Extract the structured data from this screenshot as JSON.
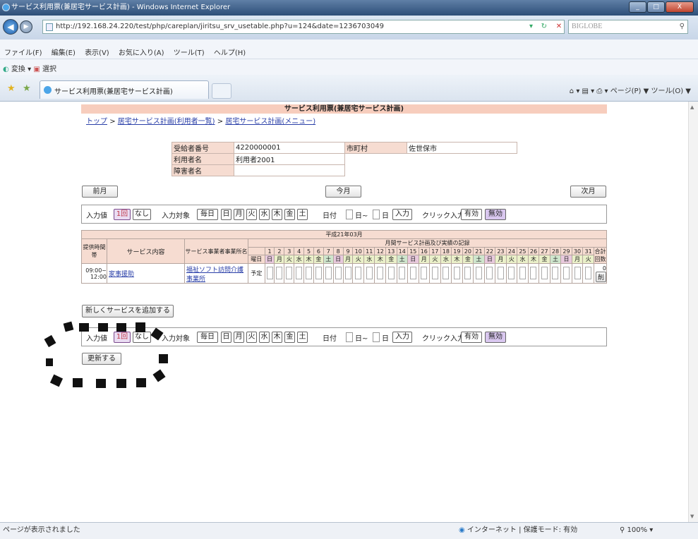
{
  "window": {
    "title": "サービス利用票(兼居宅サービス計画) - Windows Internet Explorer"
  },
  "browser": {
    "address": "http://192.168.24.220/test/php/careplan/jiritsu_srv_usetable.php?u=124&date=1236703049",
    "search_placeholder": "BIGLOBE",
    "menu": [
      "ファイル(F)",
      "編集(E)",
      "表示(V)",
      "お気に入り(A)",
      "ツール(T)",
      "ヘルプ(H)"
    ],
    "links": [
      "変換",
      "選択"
    ],
    "tab_title": "サービス利用票(兼居宅サービス計画)",
    "command_bar": "ページ(P) ▼ ツール(O) ▼",
    "status_text": "ページが表示されました",
    "zone_text": "インターネット | 保護モード: 有効",
    "zoom": "100%"
  },
  "page": {
    "title": "サービス利用票(兼居宅サービス計画)",
    "breadcrumb": [
      "トップ",
      "居宅サービス計画(利用者一覧)",
      "居宅サービス計画(メニュー)"
    ],
    "breadcrumb_sep": ">",
    "info": {
      "recipient_label": "受給者番号",
      "recipient_value": "4220000001",
      "user_label": "利用者名",
      "user_value": "利用者2001",
      "disability_label": "障害者名",
      "city_label": "市町村",
      "city_value": "佐世保市"
    },
    "nav": {
      "prev": "前月",
      "current": "今月",
      "next": "次月"
    },
    "input_row": {
      "value_label": "入力値",
      "once": "1回",
      "none": "なし",
      "target_label": "入力対象",
      "targets": [
        "毎日",
        "日",
        "月",
        "火",
        "水",
        "木",
        "金",
        "土"
      ],
      "date_label": "日付",
      "range_sep": "日~",
      "day_unit": "日",
      "input_button": "入力",
      "click_label": "クリック入力",
      "enable": "有効",
      "disable": "無効"
    },
    "grid": {
      "period": "平成21年03月",
      "col_time": "提供時間帯",
      "col_service": "サービス内容",
      "col_provider": "サービス事業者事業所名",
      "col_monthly": "月間サービス計画及び実績の記録",
      "weekday_label": "曜日",
      "total_label": "合計回数",
      "days": [
        "1",
        "2",
        "3",
        "4",
        "5",
        "6",
        "7",
        "8",
        "9",
        "10",
        "11",
        "12",
        "13",
        "14",
        "15",
        "16",
        "17",
        "18",
        "19",
        "20",
        "21",
        "22",
        "23",
        "24",
        "25",
        "26",
        "27",
        "28",
        "29",
        "30",
        "31"
      ],
      "weekdays": [
        "日",
        "月",
        "火",
        "水",
        "木",
        "金",
        "土",
        "日",
        "月",
        "火",
        "水",
        "木",
        "金",
        "土",
        "日",
        "月",
        "火",
        "水",
        "木",
        "金",
        "土",
        "日",
        "月",
        "火",
        "水",
        "木",
        "金",
        "土",
        "日",
        "月",
        "火"
      ],
      "rows": [
        {
          "time_start": "09:00~",
          "time_end": "12:00",
          "service": "家事援助",
          "provider": "福祉ソフト訪問介護事業所",
          "plan_label": "予定",
          "total": "0",
          "delete": "削"
        }
      ]
    },
    "add_service": "新しくサービスを追加する",
    "update": "更新する"
  }
}
